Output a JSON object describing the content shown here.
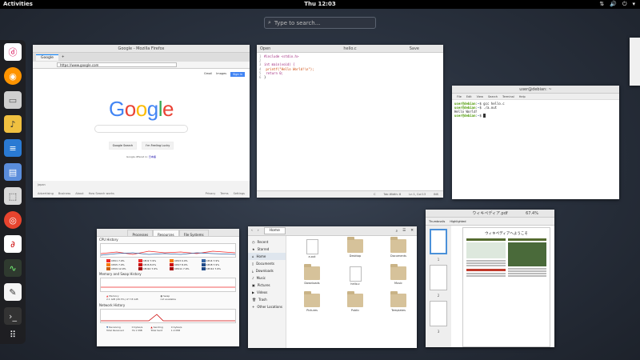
{
  "topbar": {
    "activities": "Activities",
    "clock": "Thu 12:03"
  },
  "search": {
    "placeholder": "Type to search..."
  },
  "dock": {
    "items": [
      "debian-icon",
      "firefox-icon",
      "files-icon",
      "rhythmbox-icon",
      "writer-icon",
      "disk-icon",
      "software-icon",
      "help-icon",
      "evince-icon",
      "monitor-icon",
      "gedit-icon",
      "terminal-icon",
      "app-grid-icon"
    ]
  },
  "firefox": {
    "title": "Google - Mozilla Firefox",
    "tab_label": "Google",
    "url": "https://www.google.com",
    "gmail": "Gmail",
    "images": "Images",
    "signin": "Sign in",
    "logo": [
      "G",
      "o",
      "o",
      "g",
      "l",
      "e"
    ],
    "search_button": "Google Search",
    "lucky_button": "I'm Feeling Lucky",
    "offered_in": "Google offered in:",
    "offered_lang": "日本語",
    "country": "Japan",
    "footer_left": [
      "Advertising",
      "Business",
      "About",
      "How Search works"
    ],
    "footer_right": [
      "Privacy",
      "Terms",
      "Settings"
    ]
  },
  "gedit": {
    "title": "hello.c",
    "open_label": "Open",
    "save_label": "Save",
    "lines": [
      {
        "n": "1",
        "text": "#include <stdio.h>",
        "cls": "kw"
      },
      {
        "n": "2",
        "text": "",
        "cls": ""
      },
      {
        "n": "3",
        "text": "int main(void) {",
        "cls": "kw"
      },
      {
        "n": "4",
        "text": "    printf(\"Hello World!\\n\");",
        "cls": "str"
      },
      {
        "n": "5",
        "text": "    return 0;",
        "cls": "kw"
      },
      {
        "n": "6",
        "text": "}",
        "cls": ""
      }
    ],
    "status_lang": "C",
    "status_tab": "Tab Width: 8",
    "status_pos": "Ln 1, Col 13",
    "status_mode": "INS"
  },
  "terminal": {
    "title": "user@debian: ~",
    "menu": [
      "File",
      "Edit",
      "View",
      "Search",
      "Terminal",
      "Help"
    ],
    "lines": [
      {
        "prompt": "user@debian",
        "dir": "~",
        "cmd": "$ gcc hello.c"
      },
      {
        "prompt": "user@debian",
        "dir": "~",
        "cmd": "$ ./a.out"
      },
      {
        "prompt": "",
        "dir": "",
        "cmd": "Hello World!"
      },
      {
        "prompt": "user@debian",
        "dir": "~",
        "cmd": "$ "
      }
    ]
  },
  "sysmon": {
    "tabs": [
      "Processes",
      "Resources",
      "File Systems"
    ],
    "cpu_title": "CPU History",
    "cpu_legend": [
      {
        "label": "CPU1 7.9%",
        "color": "#ef2929"
      },
      {
        "label": "CPU2 7.9%",
        "color": "#ef2929"
      },
      {
        "label": "CPU3 0.0%",
        "color": "#f57900"
      },
      {
        "label": "CPU4 7.9%",
        "color": "#3465a4"
      },
      {
        "label": "CPU5 7.9%",
        "color": "#f57900"
      },
      {
        "label": "CPU6 8.0%",
        "color": "#cc0000"
      },
      {
        "label": "CPU7 8.0%",
        "color": "#cc0000"
      },
      {
        "label": "CPU8 7.9%",
        "color": "#204a87"
      },
      {
        "label": "CPU9 12.9%",
        "color": "#ce5c00"
      },
      {
        "label": "CPU10 7.9%",
        "color": "#a40000"
      },
      {
        "label": "CPU11 7.9%",
        "color": "#a40000"
      },
      {
        "label": "CPU12 7.9%",
        "color": "#204a87"
      }
    ],
    "mem_title": "Memory and Swap History",
    "memory_label": "Memory",
    "memory_value": "2.1 GiB (26.5%) of 7.8 GiB",
    "swap_label": "Swap",
    "swap_value": "not available",
    "net_title": "Network History",
    "receiving_label": "Receiving",
    "receiving_value": "0 bytes/s",
    "total_received_label": "Total Received",
    "total_received_value": "79.1 MiB",
    "sending_label": "Sending",
    "sending_value": "0 bytes/s",
    "total_sent_label": "Total Sent",
    "total_sent_value": "1.0 MiB"
  },
  "files": {
    "location": "Home",
    "sidebar": [
      "Recent",
      "Starred",
      "Home",
      "Documents",
      "Downloads",
      "Music",
      "Pictures",
      "Videos",
      "Trash",
      "Other Locations"
    ],
    "items": [
      {
        "name": "a.out",
        "kind": "doc"
      },
      {
        "name": "Desktop",
        "kind": "folder"
      },
      {
        "name": "Documents",
        "kind": "folder"
      },
      {
        "name": "Downloads",
        "kind": "folder"
      },
      {
        "name": "hello.c",
        "kind": "doc"
      },
      {
        "name": "Music",
        "kind": "folder"
      },
      {
        "name": "Pictures",
        "kind": "folder"
      },
      {
        "name": "Public",
        "kind": "folder"
      },
      {
        "name": "Templates",
        "kind": "folder"
      }
    ]
  },
  "evince": {
    "title": "ウィキペディア.pdf",
    "zoom": "67.4%",
    "side_tabs": [
      "Thumbnails",
      "Highlighted"
    ],
    "page_heading": "ウィキペディアへようこそ",
    "page_numbers": [
      "1",
      "2",
      "3"
    ]
  }
}
